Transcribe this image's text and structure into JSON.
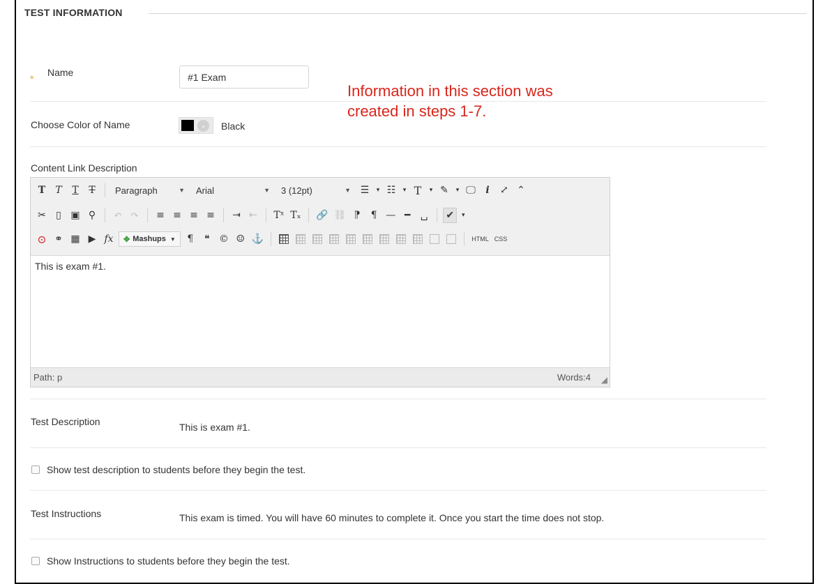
{
  "section": {
    "title": "TEST INFORMATION"
  },
  "name_field": {
    "required_mark": "*",
    "label": "Name",
    "value": "#1 Exam"
  },
  "callout": {
    "line1": "Information in this section was",
    "line2": "created in steps 1-7."
  },
  "color_field": {
    "label": "Choose Color of Name",
    "swatch_color": "#000000",
    "value": "Black"
  },
  "content_link": {
    "label": "Content Link Description",
    "toolbar": {
      "format_select": "Paragraph",
      "font_select": "Arial",
      "size_select": "3 (12pt)",
      "mashups_label": "Mashups",
      "html_label": "HTML",
      "css_label": "CSS"
    },
    "body_text": "This is exam #1.",
    "status_path": "Path: p",
    "status_words": "Words:4"
  },
  "test_description": {
    "label": "Test Description",
    "value": "This is exam #1."
  },
  "show_description": {
    "label": "Show test description to students before they begin the test.",
    "checked": false
  },
  "test_instructions": {
    "label": "Test Instructions",
    "value": "This exam is timed. You will have 60 minutes to complete it. Once you start the time does not stop."
  },
  "show_instructions": {
    "label": "Show Instructions to students before they begin the test.",
    "checked": false
  },
  "colors": {
    "callout_red": "#d9261c",
    "required_star": "#e3a23c"
  }
}
